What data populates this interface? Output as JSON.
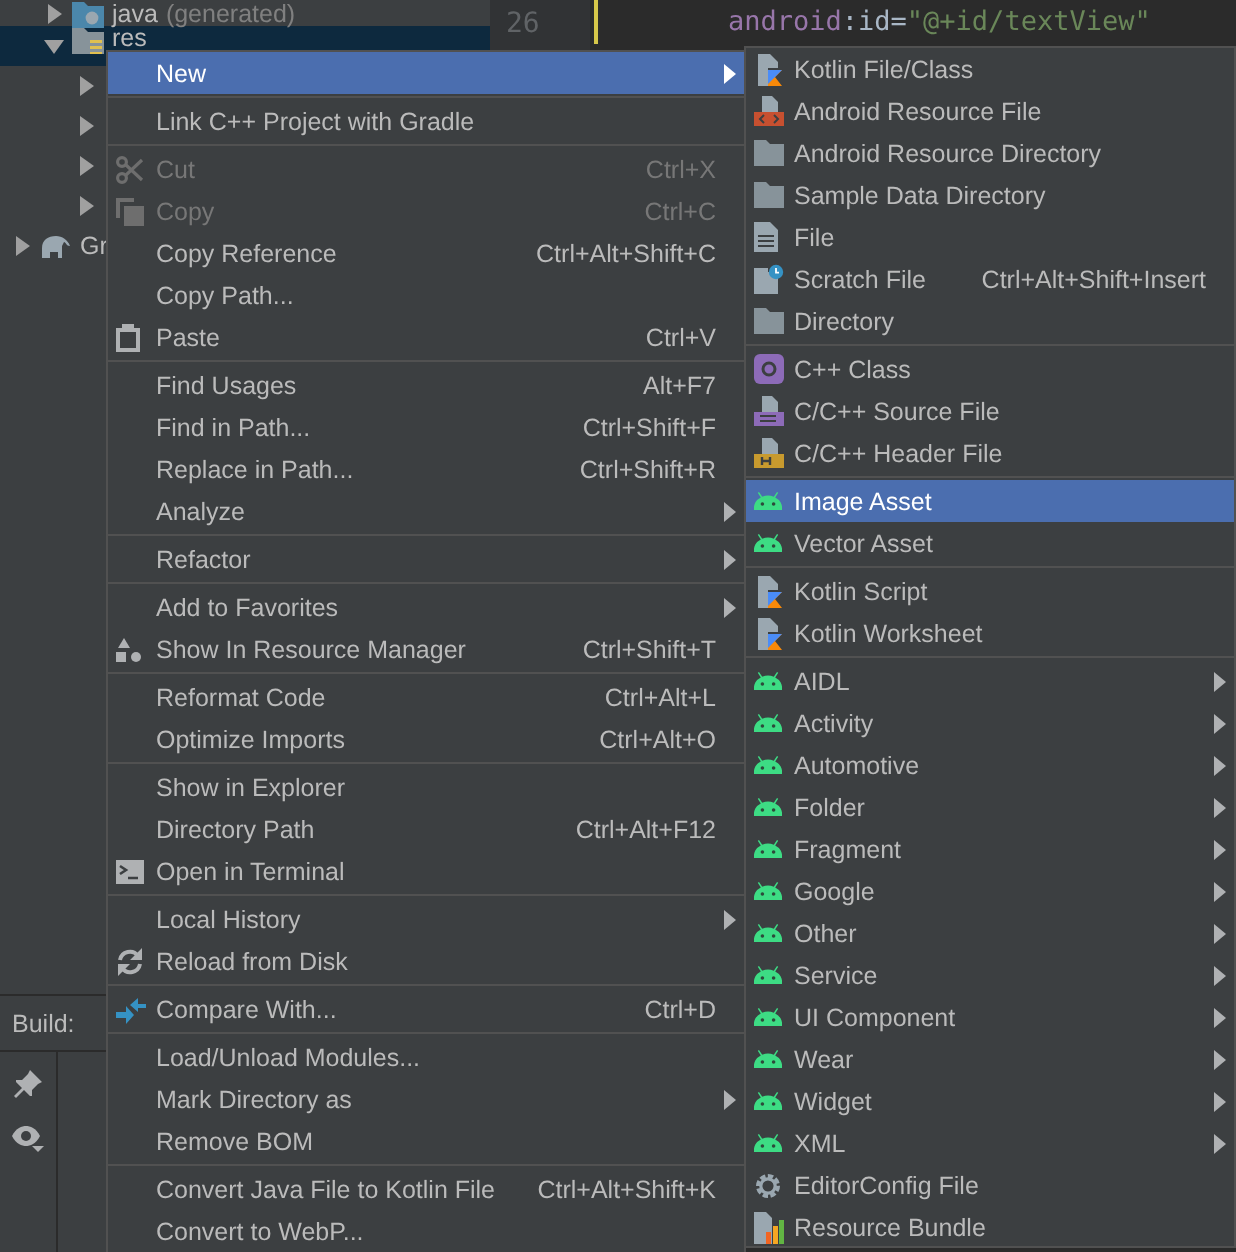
{
  "project_tree": {
    "items": [
      {
        "label": "java",
        "note": "(generated)",
        "kind": "source",
        "expanded": false,
        "selected": false
      },
      {
        "label": "res",
        "kind": "resource",
        "expanded": true,
        "selected": true,
        "children": [
          {
            "expanded": false,
            "selected": false
          },
          {
            "expanded": false,
            "selected": false
          },
          {
            "expanded": false,
            "selected": false
          },
          {
            "expanded": false,
            "selected": false
          }
        ]
      }
    ],
    "root_items": [
      {
        "label": "Gr",
        "kind": "gradle",
        "expanded": false,
        "selected": false
      }
    ]
  },
  "editor": {
    "line_number": "26",
    "tokens": [
      {
        "text": "android",
        "kind": "namespace"
      },
      {
        "text": ":id=",
        "kind": "plain"
      },
      {
        "text": "\"@+id/textView\"",
        "kind": "string"
      }
    ]
  },
  "build_panel": {
    "title": "Build:"
  },
  "context_menu": {
    "sections": [
      [
        {
          "label": "New",
          "kind": "text",
          "selected": true,
          "disabled": false,
          "submenu": true
        }
      ],
      [
        {
          "label": "Link C++ Project with Gradle",
          "kind": "text",
          "selected": false,
          "disabled": false,
          "submenu": false
        }
      ],
      [
        {
          "label": "Cut",
          "shortcut": "Ctrl+X",
          "kind": "cut",
          "selected": false,
          "disabled": true,
          "submenu": false
        },
        {
          "label": "Copy",
          "shortcut": "Ctrl+C",
          "kind": "copy",
          "selected": false,
          "disabled": true,
          "submenu": false
        },
        {
          "label": "Copy Reference",
          "shortcut": "Ctrl+Alt+Shift+C",
          "kind": "text",
          "selected": false,
          "disabled": false,
          "submenu": false
        },
        {
          "label": "Copy Path...",
          "kind": "text",
          "selected": false,
          "disabled": false,
          "submenu": false
        },
        {
          "label": "Paste",
          "shortcut": "Ctrl+V",
          "kind": "paste",
          "selected": false,
          "disabled": false,
          "submenu": false
        }
      ],
      [
        {
          "label": "Find Usages",
          "shortcut": "Alt+F7",
          "kind": "text",
          "selected": false,
          "disabled": false,
          "submenu": false
        },
        {
          "label": "Find in Path...",
          "shortcut": "Ctrl+Shift+F",
          "kind": "text",
          "selected": false,
          "disabled": false,
          "submenu": false
        },
        {
          "label": "Replace in Path...",
          "shortcut": "Ctrl+Shift+R",
          "kind": "text",
          "selected": false,
          "disabled": false,
          "submenu": false
        },
        {
          "label": "Analyze",
          "kind": "text",
          "selected": false,
          "disabled": false,
          "submenu": true
        }
      ],
      [
        {
          "label": "Refactor",
          "kind": "text",
          "selected": false,
          "disabled": false,
          "submenu": true
        }
      ],
      [
        {
          "label": "Add to Favorites",
          "kind": "text",
          "selected": false,
          "disabled": false,
          "submenu": true
        },
        {
          "label": "Show In Resource Manager",
          "shortcut": "Ctrl+Shift+T",
          "kind": "resources",
          "selected": false,
          "disabled": false,
          "submenu": false
        }
      ],
      [
        {
          "label": "Reformat Code",
          "shortcut": "Ctrl+Alt+L",
          "kind": "text",
          "selected": false,
          "disabled": false,
          "submenu": false
        },
        {
          "label": "Optimize Imports",
          "shortcut": "Ctrl+Alt+O",
          "kind": "text",
          "selected": false,
          "disabled": false,
          "submenu": false
        }
      ],
      [
        {
          "label": "Show in Explorer",
          "kind": "text",
          "selected": false,
          "disabled": false,
          "submenu": false
        },
        {
          "label": "Directory Path",
          "shortcut": "Ctrl+Alt+F12",
          "kind": "text",
          "selected": false,
          "disabled": false,
          "submenu": false
        },
        {
          "label": "Open in Terminal",
          "kind": "terminal",
          "selected": false,
          "disabled": false,
          "submenu": false
        }
      ],
      [
        {
          "label": "Local History",
          "kind": "text",
          "selected": false,
          "disabled": false,
          "submenu": true
        },
        {
          "label": "Reload from Disk",
          "kind": "reload",
          "selected": false,
          "disabled": false,
          "submenu": false
        }
      ],
      [
        {
          "label": "Compare With...",
          "shortcut": "Ctrl+D",
          "kind": "compare",
          "selected": false,
          "disabled": false,
          "submenu": false
        }
      ],
      [
        {
          "label": "Load/Unload Modules...",
          "kind": "text",
          "selected": false,
          "disabled": false,
          "submenu": false
        },
        {
          "label": "Mark Directory as",
          "kind": "text",
          "selected": false,
          "disabled": false,
          "submenu": true
        },
        {
          "label": "Remove BOM",
          "kind": "text",
          "selected": false,
          "disabled": false,
          "submenu": false
        }
      ],
      [
        {
          "label": "Convert Java File to Kotlin File",
          "shortcut": "Ctrl+Alt+Shift+K",
          "kind": "text",
          "selected": false,
          "disabled": false,
          "submenu": false
        },
        {
          "label": "Convert to WebP...",
          "kind": "text",
          "selected": false,
          "disabled": false,
          "submenu": false
        }
      ]
    ]
  },
  "new_submenu": {
    "sections": [
      [
        {
          "label": "Kotlin File/Class",
          "kind": "kotlin",
          "selected": false,
          "submenu": false
        },
        {
          "label": "Android Resource File",
          "kind": "resource",
          "selected": false,
          "submenu": false
        },
        {
          "label": "Android Resource Directory",
          "kind": "directory",
          "selected": false,
          "submenu": false
        },
        {
          "label": "Sample Data Directory",
          "kind": "directory",
          "selected": false,
          "submenu": false
        },
        {
          "label": "File",
          "kind": "file",
          "selected": false,
          "submenu": false
        },
        {
          "label": "Scratch File",
          "shortcut": "Ctrl+Alt+Shift+Insert",
          "kind": "scratch",
          "selected": false,
          "submenu": false
        },
        {
          "label": "Directory",
          "kind": "directory",
          "selected": false,
          "submenu": false
        }
      ],
      [
        {
          "label": "C++ Class",
          "kind": "class",
          "selected": false,
          "submenu": false
        },
        {
          "label": "C/C++ Source File",
          "kind": "source",
          "selected": false,
          "submenu": false
        },
        {
          "label": "C/C++ Header File",
          "kind": "header",
          "selected": false,
          "submenu": false
        }
      ],
      [
        {
          "label": "Image Asset",
          "kind": "android",
          "selected": true,
          "submenu": false
        },
        {
          "label": "Vector Asset",
          "kind": "android",
          "selected": false,
          "submenu": false
        }
      ],
      [
        {
          "label": "Kotlin Script",
          "kind": "kotlin",
          "selected": false,
          "submenu": false
        },
        {
          "label": "Kotlin Worksheet",
          "kind": "kotlin",
          "selected": false,
          "submenu": false
        }
      ],
      [
        {
          "label": "AIDL",
          "kind": "android",
          "selected": false,
          "submenu": true
        },
        {
          "label": "Activity",
          "kind": "android",
          "selected": false,
          "submenu": true
        },
        {
          "label": "Automotive",
          "kind": "android",
          "selected": false,
          "submenu": true
        },
        {
          "label": "Folder",
          "kind": "android",
          "selected": false,
          "submenu": true
        },
        {
          "label": "Fragment",
          "kind": "android",
          "selected": false,
          "submenu": true
        },
        {
          "label": "Google",
          "kind": "android",
          "selected": false,
          "submenu": true
        },
        {
          "label": "Other",
          "kind": "android",
          "selected": false,
          "submenu": true
        },
        {
          "label": "Service",
          "kind": "android",
          "selected": false,
          "submenu": true
        },
        {
          "label": "UI Component",
          "kind": "android",
          "selected": false,
          "submenu": true
        },
        {
          "label": "Wear",
          "kind": "android",
          "selected": false,
          "submenu": true
        },
        {
          "label": "Widget",
          "kind": "android",
          "selected": false,
          "submenu": true
        },
        {
          "label": "XML",
          "kind": "android",
          "selected": false,
          "submenu": true
        },
        {
          "label": "EditorConfig File",
          "kind": "config",
          "selected": false,
          "submenu": false
        },
        {
          "label": "Resource Bundle",
          "kind": "bundle",
          "selected": false,
          "submenu": false
        }
      ]
    ]
  }
}
